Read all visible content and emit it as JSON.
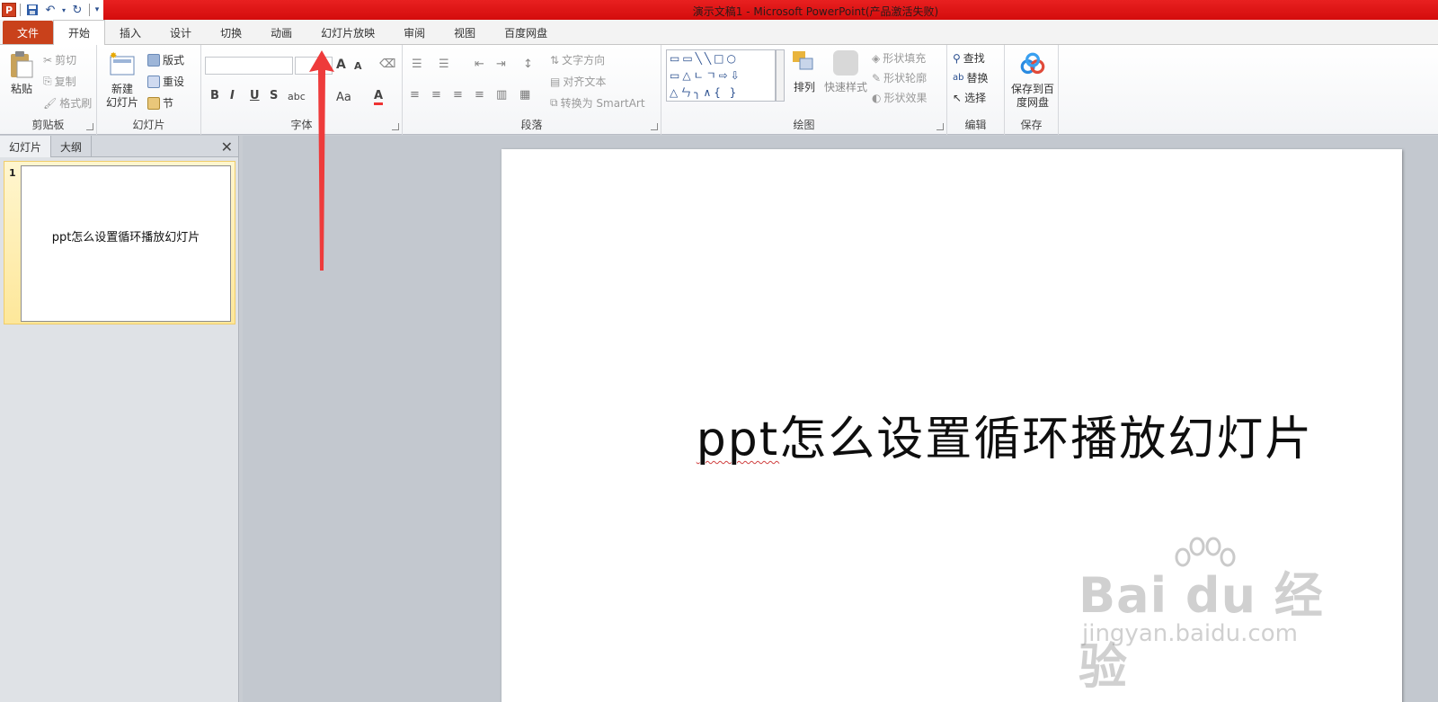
{
  "titlebar": {
    "title": "演示文稿1 - Microsoft PowerPoint(产品激活失败)",
    "logo_letter": "P"
  },
  "tabs": [
    {
      "label": "文件"
    },
    {
      "label": "开始"
    },
    {
      "label": "插入"
    },
    {
      "label": "设计"
    },
    {
      "label": "切换"
    },
    {
      "label": "动画"
    },
    {
      "label": "幻灯片放映"
    },
    {
      "label": "审阅"
    },
    {
      "label": "视图"
    },
    {
      "label": "百度网盘"
    }
  ],
  "ribbon": {
    "clipboard": {
      "label": "剪贴板",
      "paste": "粘贴",
      "cut": "剪切",
      "copy": "复制",
      "painter": "格式刷"
    },
    "slides": {
      "label": "幻灯片",
      "new_slide_1": "新建",
      "new_slide_2": "幻灯片",
      "layout": "版式",
      "reset": "重设",
      "section": "节"
    },
    "font": {
      "label": "字体",
      "grow": "A",
      "shrink": "A",
      "bold": "B",
      "italic": "I",
      "underline": "U",
      "strike": "S",
      "spacing": "abc",
      "case": "Aa",
      "color": "A"
    },
    "paragraph": {
      "label": "段落",
      "text_direction": "文字方向",
      "align_text": "对齐文本",
      "smartart": "转换为 SmartArt"
    },
    "drawing": {
      "label": "绘图",
      "arrange": "排列",
      "quick_styles": "快速样式",
      "shape_fill": "形状填充",
      "shape_outline": "形状轮廓",
      "shape_effects": "形状效果",
      "shapes_row1": "▭▭╲╲□○",
      "shapes_row2": "▭△ㄴㄱ⇨⇩",
      "shapes_row3": "△ㄣ╮∧{ }"
    },
    "editing": {
      "label": "编辑",
      "find": "查找",
      "replace": "替换",
      "select": "选择"
    },
    "save": {
      "label": "保存",
      "save_1": "保存到百",
      "save_2": "度网盘"
    }
  },
  "left_panel": {
    "tab_slides": "幻灯片",
    "tab_outline": "大纲",
    "close": "✕",
    "thumbnail": {
      "number": "1",
      "text": "ppt怎么设置循环播放幻灯片"
    }
  },
  "slide": {
    "title_latin": "ppt",
    "title_rest": "怎么设置循环播放幻灯片"
  },
  "watermark": {
    "line1": "Bai du 经验",
    "line2": "jingyan.baidu.com"
  },
  "colors": {
    "title_band": "#e01414",
    "file_tab": "#c9411b",
    "thumb_highlight": "#fde79a",
    "annotation_arrow": "#ee3b3b"
  }
}
